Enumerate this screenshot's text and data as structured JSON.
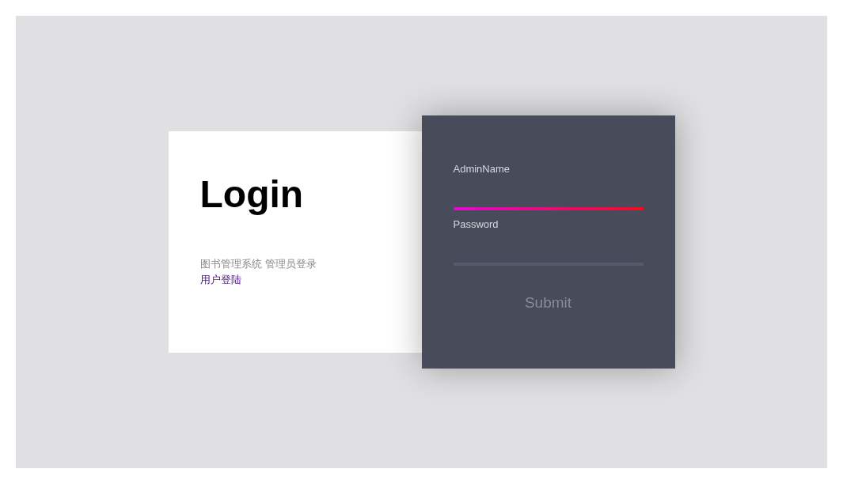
{
  "intro": {
    "title": "Login",
    "subtitle": "图书管理系统 管理员登录",
    "link": "用户登陆"
  },
  "form": {
    "fields": [
      {
        "label": "AdminName",
        "focused": true
      },
      {
        "label": "Password",
        "focused": false
      }
    ],
    "submit": "Submit"
  }
}
